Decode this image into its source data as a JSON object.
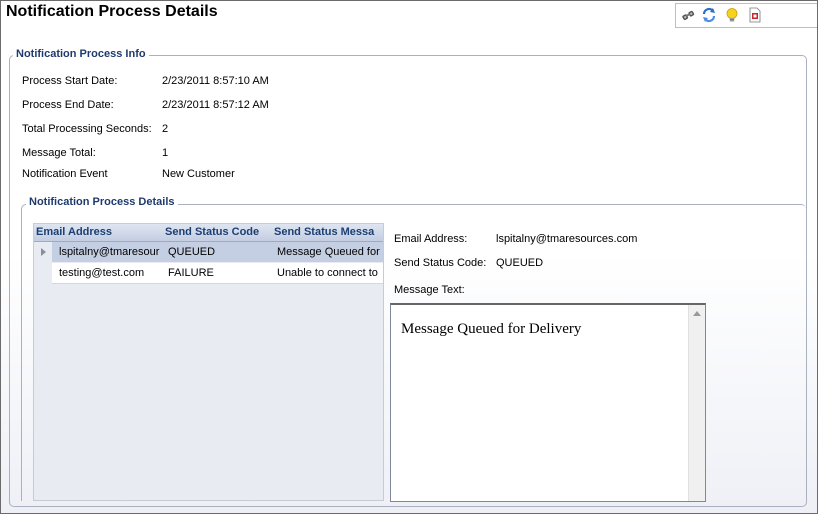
{
  "page": {
    "title": "Notification Process Details"
  },
  "toolbar": {
    "icons": [
      "binoculars-icon",
      "refresh-icon",
      "lightbulb-icon",
      "pdf-report-icon"
    ]
  },
  "info": {
    "legend": "Notification Process Info",
    "fields": [
      {
        "label": "Process Start Date:",
        "value": "2/23/2011 8:57:10 AM"
      },
      {
        "label": "Process End Date:",
        "value": "2/23/2011 8:57:12 AM"
      },
      {
        "label": "Total Processing Seconds:",
        "value": "2"
      },
      {
        "label": "Message Total:",
        "value": "1"
      },
      {
        "label": "Notification Event",
        "value": "New Customer"
      }
    ]
  },
  "details": {
    "legend": "Notification Process Details",
    "grid": {
      "columns": [
        "Email Address",
        "Send Status Code",
        "Send Status Messa"
      ],
      "rows": [
        {
          "email": "lspitalny@tmaresour",
          "code": "QUEUED",
          "message": "Message Queued for"
        },
        {
          "email": "testing@test.com",
          "code": "FAILURE",
          "message": "Unable to connect to"
        }
      ]
    },
    "selected": {
      "email_label": "Email Address:",
      "email_value": "lspitalny@tmaresources.com",
      "code_label": "Send Status Code:",
      "code_value": "QUEUED",
      "message_label": "Message Text:",
      "message_value": "Message Queued for Delivery"
    }
  },
  "colors": {
    "legend_text": "#1f3a6e",
    "grid_header_text": "#1c3f73",
    "selected_row": "#c5cfe3"
  }
}
